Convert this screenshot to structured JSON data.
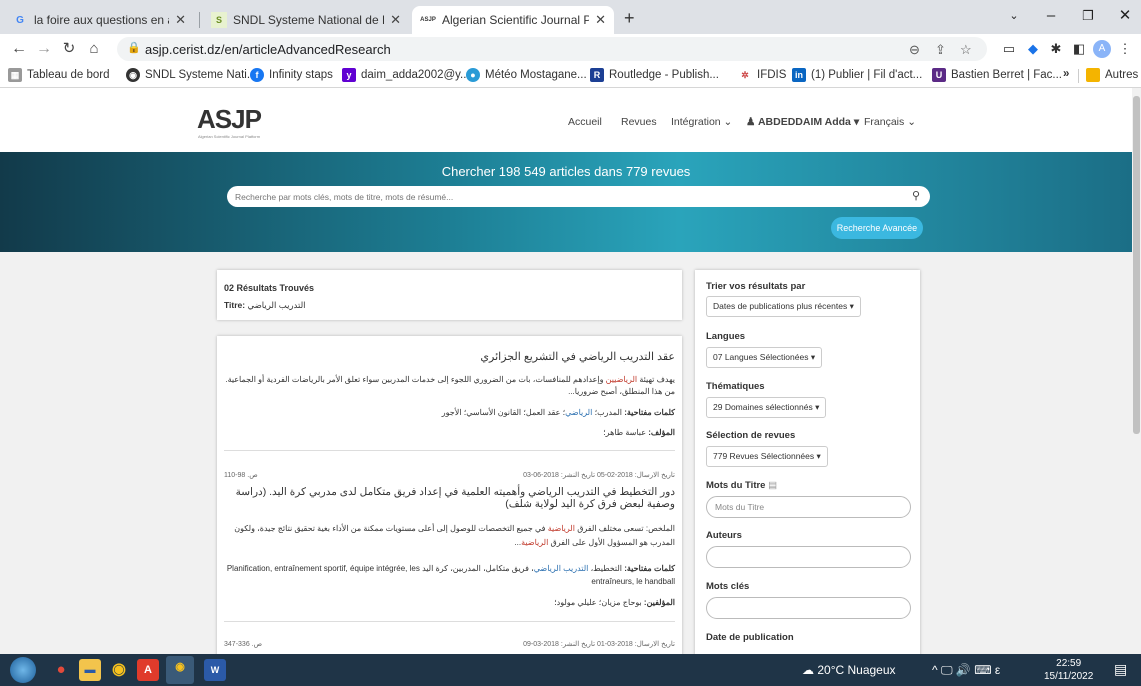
{
  "browser": {
    "tabs": [
      {
        "title": "la foire aux questions en arabe -",
        "favicon": "G",
        "active": false
      },
      {
        "title": "SNDL Systeme National de Docu",
        "favicon": "S",
        "active": false
      },
      {
        "title": "Algerian Scientific Journal Platfor",
        "favicon": "ASJP",
        "active": true
      }
    ],
    "new_tab": "+",
    "url": "asjp.cerist.dz/en/articleAdvancedResearch",
    "bookmarks": [
      "Tableau de bord",
      "SNDL Systeme Nati...",
      "Infinity staps",
      "daim_adda2002@y...",
      "Météo Mostagane...",
      "Routledge - Publish...",
      "IFDIS",
      "(1) Publier | Fil d'act...",
      "Bastien Berret | Fac...",
      "»",
      "Autres favoris"
    ],
    "profile_initial": "A"
  },
  "site": {
    "logo_main": "ASJP",
    "logo_sub": "Algerian Scientific Journal Platform",
    "nav": {
      "home": "Accueil",
      "journals": "Revues",
      "integration": "Intégration",
      "user": "ABDEDDAIM Adda",
      "language": "Français"
    },
    "hero_title": "Chercher 198 549 articles dans 779 revues",
    "search_placeholder": "Recherche par mots clés, mots de titre, mots de résumé...",
    "advanced_button": "Recherche Avancée"
  },
  "results": {
    "count": "02 Résultats Trouvés",
    "query_label": "Titre:",
    "query_value": "التدريب الرياضي",
    "items": [
      {
        "title": "عقد التدريب الرياضي في التشريع الجزائري",
        "abstract_pre": "يهدف تهيئة ",
        "abstract_hl": "الرياضيين",
        "abstract_post": " وإعدادهم للمنافسات، بات من الضروري اللجوء إلى خدمات المدربين سواء تعلق الأمر بالرياضات الفردية أو الجماعية. من هذا المنطلق، أصبح ضروريا...",
        "keywords_label": "كلمات مفتاحية:",
        "keywords_pre": " المدرب؛ ",
        "keywords_hl": "الرياضي",
        "keywords_post": "؛ عقد العمل؛ القانون الأساسي؛ الأجور",
        "authors_label": "المؤلف:",
        "authors": " عباسة طاهر؛"
      },
      {
        "meta_dates": "تاريخ الارسال: 2018-02-05   تاريخ النشر: 2018-06-03",
        "pages": "ص. 98-110",
        "title": "دور التخطيط في التدريب الرياضي وأهميته العلمية في إعداد فريق متكامل لدى مدربي كرة اليد. (دراسة وصفية لبعض فرق كرة اليد لولاية شلف)",
        "abstract_pre": "الملخص: تسعى مختلف الفرق ",
        "abstract_hl": "الرياضية",
        "abstract_post": " في جميع التخصصات للوصول إلى أعلى مستويات ممكنة من الأداء بغية تحقيق نتائج جيدة، ولكون المدرب هو المسؤول الأول على الفرق ",
        "abstract_hl2": "الرياضية",
        "abstract_end": "...",
        "keywords_label": "كلمات مفتاحية:",
        "keywords_pre": " التخطيط، ",
        "keywords_hl": "التدريب الرياضي",
        "keywords_post": "، فريق متكامل، المدربين، كرة اليد Planification, entraînement sportif, équipe intégrée, les entraîneurs, le handball",
        "authors_label": "المؤلفين:",
        "authors": " بوحاج مزيان؛ عليلي مولود؛"
      },
      {
        "meta_dates": "تاريخ الارسال: 2018-03-01   تاريخ النشر: 2018-03-09",
        "pages": "ص. 336-347"
      }
    ]
  },
  "filters": {
    "sort_label": "Trier vos résultats par",
    "sort_value": "Dates de publications plus récentes",
    "languages_label": "Langues",
    "languages_value": "07 Langues Sélectionées",
    "themes_label": "Thématiques",
    "themes_value": "29 Domaines sélectionnés",
    "journals_label": "Sélection de revues",
    "journals_value": "779 Revues Sélectionnées",
    "title_words_label": "Mots du Titre",
    "title_words_placeholder": "Mots du Titre",
    "authors_label": "Auteurs",
    "keywords_label": "Mots clés",
    "pubdate_label": "Date de publication"
  },
  "taskbar": {
    "weather": "20°C Nuageux",
    "time": "22:59",
    "date": "15/11/2022"
  }
}
